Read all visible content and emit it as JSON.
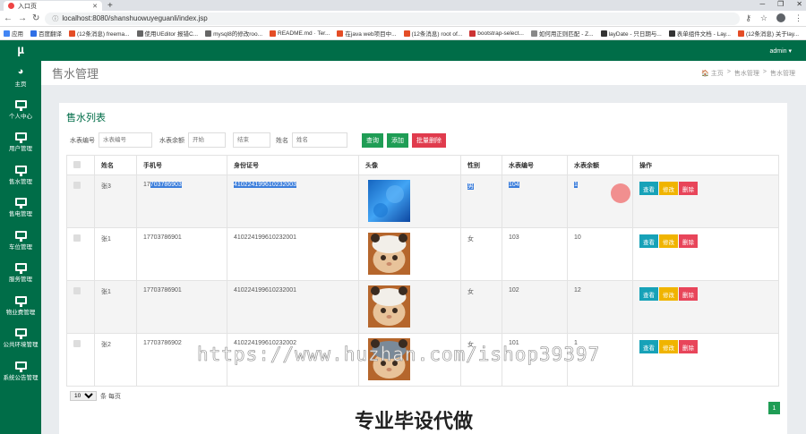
{
  "browser": {
    "tab_title": "入口页",
    "url": "localhost:8080/shanshuowuyeguanli/index.jsp",
    "bookmarks": [
      {
        "label": "应用",
        "color": "#4285f4"
      },
      {
        "label": "百度翻译",
        "color": "#2f6fe6"
      },
      {
        "label": "(12条消息) freema...",
        "color": "#e44d26"
      },
      {
        "label": "使用UEditor 报错C...",
        "color": "#666666"
      },
      {
        "label": "mysql8的修改roo...",
        "color": "#666666"
      },
      {
        "label": "README.md · Ter...",
        "color": "#e44d26"
      },
      {
        "label": "在java web项目中...",
        "color": "#e44d26"
      },
      {
        "label": "(12条消息) root of...",
        "color": "#e44d26"
      },
      {
        "label": "bootstrap-select...",
        "color": "#c33"
      },
      {
        "label": "如何用正则匹配 - Z...",
        "color": "#888888"
      },
      {
        "label": "layDate - 只日期与...",
        "color": "#333333"
      },
      {
        "label": "表单组件文档 - Lay...",
        "color": "#333333"
      },
      {
        "label": "(12条消息) 关于lay...",
        "color": "#e44d26"
      }
    ]
  },
  "app": {
    "logo": "µ",
    "user": "admin ▾",
    "sidebar": [
      {
        "label": "主页",
        "icon": "dashboard-icon"
      },
      {
        "label": "个人中心",
        "icon": "monitor-icon"
      },
      {
        "label": "用户管理",
        "icon": "monitor-icon"
      },
      {
        "label": "售水管理",
        "icon": "monitor-icon"
      },
      {
        "label": "售电管理",
        "icon": "monitor-icon"
      },
      {
        "label": "车位管理",
        "icon": "monitor-icon"
      },
      {
        "label": "服务管理",
        "icon": "monitor-icon"
      },
      {
        "label": "物业费管理",
        "icon": "monitor-icon"
      },
      {
        "label": "公共环境管理",
        "icon": "monitor-icon"
      },
      {
        "label": "系统公告管理",
        "icon": "monitor-icon"
      }
    ],
    "page_title": "售水管理",
    "breadcrumb": [
      "🏠 主页",
      ">",
      "售水管理",
      ">",
      "售水管理"
    ],
    "panel_title": "售水列表",
    "search": {
      "label1": "水表编号",
      "placeholder1": "水表编号",
      "label2": "水表余额",
      "placeholder2": "开始",
      "placeholder3": "结束",
      "label4": "姓名",
      "placeholder4": "姓名",
      "query": "查询",
      "add": "添加",
      "batch_delete": "批量删除"
    },
    "table": {
      "headers": [
        "",
        "姓名",
        "手机号",
        "身份证号",
        "头像",
        "性别",
        "水表编号",
        "水表余额",
        "操作"
      ],
      "rows": [
        {
          "name": "张3",
          "phone_a": "17",
          "phone_b": "703786903",
          "idcard": "410224199610232003",
          "gender": "男",
          "meter": "104",
          "balance": "1",
          "avatar": "blue"
        },
        {
          "name": "张1",
          "phone_a": "17703786901",
          "phone_b": "",
          "idcard": "410224199610232001",
          "gender": "女",
          "meter": "103",
          "balance": "10",
          "avatar": "cat"
        },
        {
          "name": "张1",
          "phone_a": "17703786901",
          "phone_b": "",
          "idcard": "410224199610232001",
          "gender": "女",
          "meter": "102",
          "balance": "12",
          "avatar": "cat"
        },
        {
          "name": "张2",
          "phone_a": "17703786902",
          "phone_b": "",
          "idcard": "410224199610232002",
          "gender": "女",
          "meter": "101",
          "balance": "1",
          "avatar": "cat2"
        }
      ],
      "view": "查看",
      "edit": "修改",
      "delete": "删除"
    },
    "pager": {
      "page_size": "10",
      "suffix": "条 每页",
      "current": "1"
    }
  },
  "overlay": {
    "watermark": "https://www.huzhan.com/ishop39397",
    "caption": "专业毕设代做"
  },
  "colors": {
    "brand": "#006d48",
    "query": "#1f9d55",
    "delete": "#e03b4d",
    "view": "#17a2b8",
    "edit": "#f0b400"
  }
}
